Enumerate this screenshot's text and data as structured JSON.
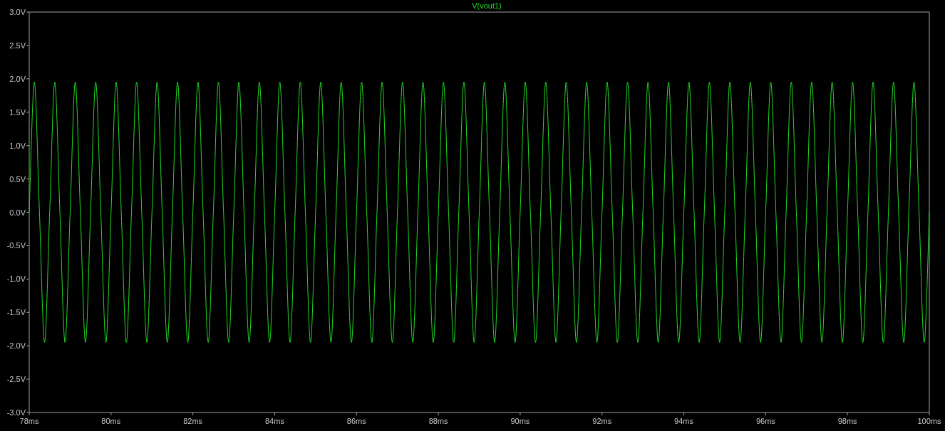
{
  "plot": {
    "chart_data": {
      "type": "line",
      "x": [
        78,
        78.125,
        78.25,
        78.375,
        78.5,
        78.625,
        78.75,
        78.875,
        79,
        79.125,
        79.25,
        79.375,
        79.5,
        79.625,
        79.75,
        79.875,
        80,
        80.125,
        80.25,
        80.375,
        80.5,
        80.625,
        80.75,
        80.875,
        81,
        81.125,
        81.25,
        81.375,
        81.5,
        81.625,
        81.75,
        81.875,
        82,
        82.125,
        82.25,
        82.375,
        82.5,
        82.625,
        82.75,
        82.875,
        83,
        83.125,
        83.25,
        83.375,
        83.5,
        83.625,
        83.75,
        83.875,
        84,
        84.125,
        84.25,
        84.375,
        84.5,
        84.625,
        84.75,
        84.875,
        85,
        85.125,
        85.25,
        85.375,
        85.5,
        85.625,
        85.75,
        85.875,
        86,
        86.125,
        86.25,
        86.375,
        86.5,
        86.625,
        86.75,
        86.875,
        87,
        87.125,
        87.25,
        87.375,
        87.5,
        87.625,
        87.75,
        87.875,
        88,
        88.125,
        88.25,
        88.375,
        88.5,
        88.625,
        88.75,
        88.875,
        89,
        89.125,
        89.25,
        89.375,
        89.5,
        89.625,
        89.75,
        89.875,
        90,
        90.125,
        90.25,
        90.375,
        90.5,
        90.625,
        90.75,
        90.875,
        91,
        91.125,
        91.25,
        91.375,
        91.5,
        91.625,
        91.75,
        91.875,
        92,
        92.125,
        92.25,
        92.375,
        92.5,
        92.625,
        92.75,
        92.875,
        93,
        93.125,
        93.25,
        93.375,
        93.5,
        93.625,
        93.75,
        93.875,
        94,
        94.125,
        94.25,
        94.375,
        94.5,
        94.625,
        94.75,
        94.875,
        95,
        95.125,
        95.25,
        95.375,
        95.5,
        95.625,
        95.75,
        95.875,
        96,
        96.125,
        96.25,
        96.375,
        96.5,
        96.625,
        96.75,
        96.875,
        97,
        97.125,
        97.25,
        97.375,
        97.5,
        97.625,
        97.75,
        97.875,
        98,
        98.125,
        98.25,
        98.375,
        98.5,
        98.625,
        98.75,
        98.875,
        99,
        99.125,
        99.25,
        99.375,
        99.5,
        99.625,
        99.75,
        99.875,
        100
      ],
      "series": [
        {
          "name": "V(vout1)",
          "color": "#22dd22",
          "values": [
            0,
            1.95,
            0,
            -1.95,
            0,
            1.95,
            0,
            -1.95,
            0,
            1.95,
            0,
            -1.95,
            0,
            1.95,
            0,
            -1.95,
            0,
            1.95,
            0,
            -1.95,
            0,
            1.95,
            0,
            -1.95,
            0,
            1.95,
            0,
            -1.95,
            0,
            1.95,
            0,
            -1.95,
            0,
            1.95,
            0,
            -1.95,
            0,
            1.95,
            0,
            -1.95,
            0,
            1.95,
            0,
            -1.95,
            0,
            1.95,
            0,
            -1.95,
            0,
            1.95,
            0,
            -1.95,
            0,
            1.95,
            0,
            -1.95,
            0,
            1.95,
            0,
            -1.95,
            0,
            1.95,
            0,
            -1.95,
            0,
            1.95,
            0,
            -1.95,
            0,
            1.95,
            0,
            -1.95,
            0,
            1.95,
            0,
            -1.95,
            0,
            1.95,
            0,
            -1.95,
            0,
            1.95,
            0,
            -1.95,
            0,
            1.95,
            0,
            -1.95,
            0,
            1.95,
            0,
            -1.95,
            0,
            1.95,
            0,
            -1.95,
            0,
            1.95,
            0,
            -1.95,
            0,
            1.95,
            0,
            -1.95,
            0,
            1.95,
            0,
            -1.95,
            0,
            1.95,
            0,
            -1.95,
            0,
            1.95,
            0,
            -1.95,
            0,
            1.95,
            0,
            -1.95,
            0,
            1.95,
            0,
            -1.95,
            0,
            1.95,
            0,
            -1.95,
            0,
            1.95,
            0,
            -1.95,
            0,
            1.95,
            0,
            -1.95,
            0,
            1.95,
            0,
            -1.95,
            0,
            1.95,
            0,
            -1.95,
            0,
            1.95,
            0,
            -1.95,
            0,
            1.95,
            0,
            -1.95,
            0,
            1.95,
            0,
            -1.95,
            0,
            1.95,
            0,
            -1.95,
            0,
            1.95,
            0,
            -1.95,
            0,
            1.95,
            0,
            -1.95,
            0,
            1.95,
            0,
            -1.95,
            0,
            1.95,
            0,
            -1.95,
            0
          ]
        }
      ],
      "xlim": [
        78,
        100
      ],
      "ylim": [
        -3,
        3
      ],
      "xticks": [
        {
          "value": 78,
          "label": "78ms"
        },
        {
          "value": 80,
          "label": "80ms"
        },
        {
          "value": 82,
          "label": "82ms"
        },
        {
          "value": 84,
          "label": "84ms"
        },
        {
          "value": 86,
          "label": "86ms"
        },
        {
          "value": 88,
          "label": "88ms"
        },
        {
          "value": 90,
          "label": "90ms"
        },
        {
          "value": 92,
          "label": "92ms"
        },
        {
          "value": 94,
          "label": "94ms"
        },
        {
          "value": 96,
          "label": "96ms"
        },
        {
          "value": 98,
          "label": "98ms"
        },
        {
          "value": 100,
          "label": "100ms"
        }
      ],
      "yticks": [
        {
          "value": 3,
          "label": "3.0V"
        },
        {
          "value": 2.5,
          "label": "2.5V"
        },
        {
          "value": 2,
          "label": "2.0V"
        },
        {
          "value": 1.5,
          "label": "1.5V"
        },
        {
          "value": 1,
          "label": "1.0V"
        },
        {
          "value": 0.5,
          "label": "0.5V"
        },
        {
          "value": 0,
          "label": "0.0V"
        },
        {
          "value": -0.5,
          "label": "-0.5V"
        },
        {
          "value": -1,
          "label": "-1.0V"
        },
        {
          "value": -1.5,
          "label": "-1.5V"
        },
        {
          "value": -2,
          "label": "-2.0V"
        },
        {
          "value": -2.5,
          "label": "-2.5V"
        },
        {
          "value": -3,
          "label": "-3.0V"
        }
      ]
    }
  }
}
